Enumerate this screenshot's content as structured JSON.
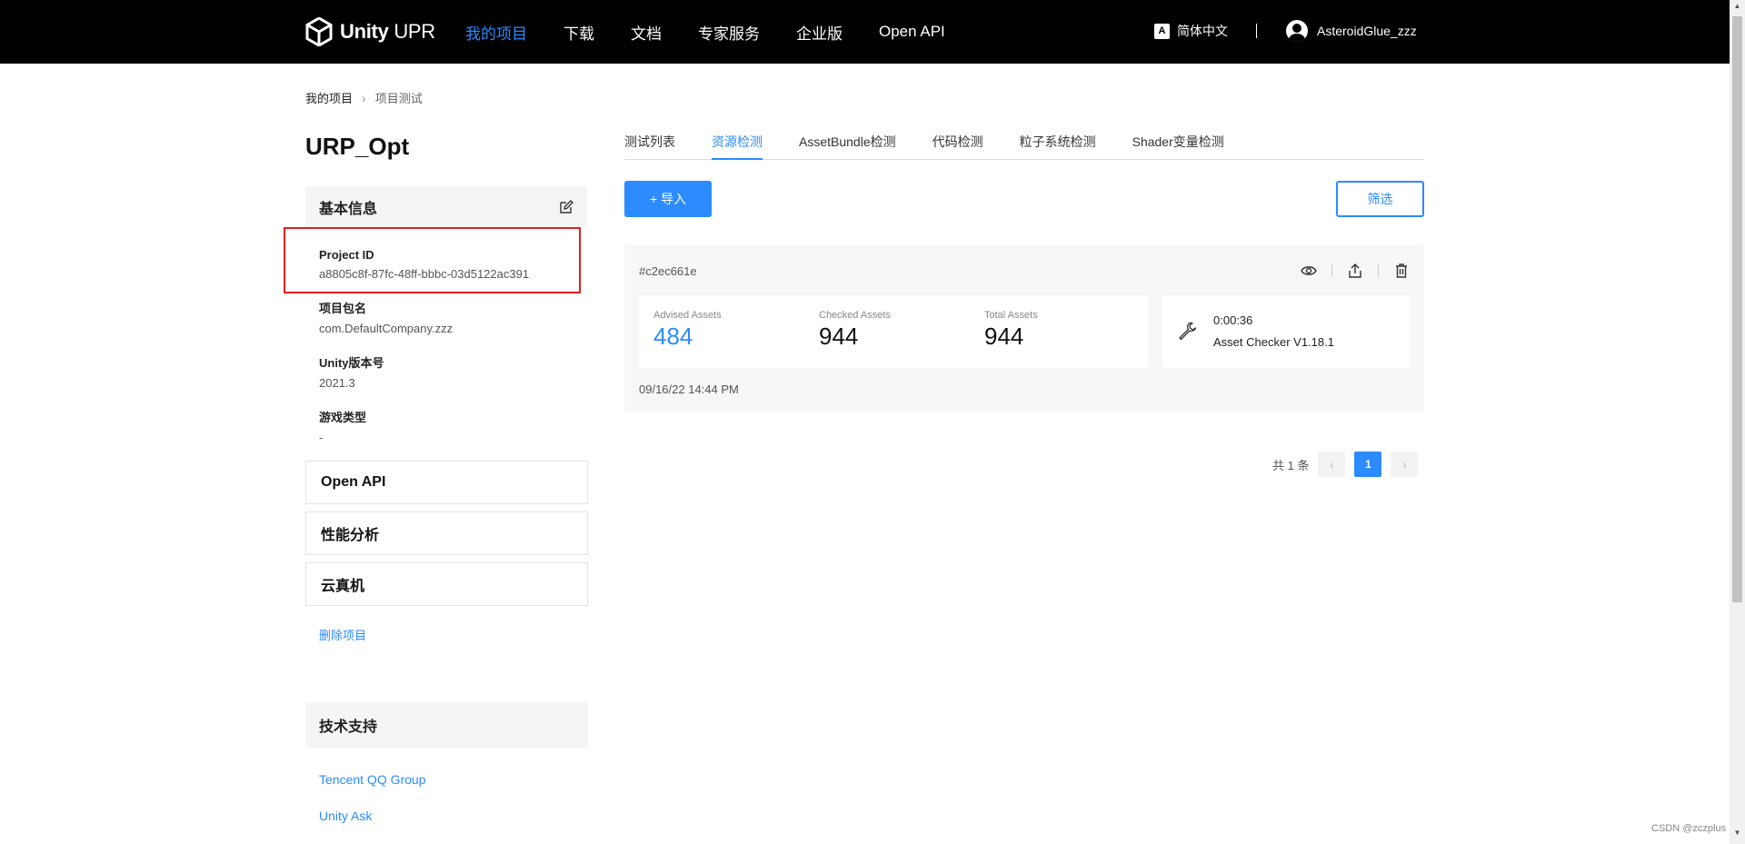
{
  "header": {
    "logo_text": "Unity",
    "logo_suffix": "UPR",
    "nav": [
      "我的项目",
      "下载",
      "文档",
      "专家服务",
      "企业版",
      "Open API"
    ],
    "language": "简体中文",
    "lang_icon": "A",
    "username": "AsteroidGlue_zzz"
  },
  "breadcrumb": {
    "root": "我的项目",
    "current": "项目测试"
  },
  "project": {
    "title": "URP_Opt"
  },
  "basic_info": {
    "title": "基本信息",
    "fields": [
      {
        "label": "Project ID",
        "value": "a8805c8f-87fc-48ff-bbbc-03d5122ac391"
      },
      {
        "label": "项目包名",
        "value": "com.DefaultCompany.zzz"
      },
      {
        "label": "Unity版本号",
        "value": "2021.3"
      },
      {
        "label": "游戏类型",
        "value": "-"
      }
    ]
  },
  "sections": [
    "Open API",
    "性能分析",
    "云真机"
  ],
  "delete_label": "删除项目",
  "support": {
    "title": "技术支持",
    "links": [
      "Tencent QQ Group",
      "Unity Ask"
    ]
  },
  "tabs": [
    "测试列表",
    "资源检测",
    "AssetBundle检测",
    "代码检测",
    "粒子系统检测",
    "Shader变量检测"
  ],
  "active_tab": "资源检测",
  "import_label": "+ 导入",
  "filter_label": "筛选",
  "report": {
    "id": "#c2ec661e",
    "stats": [
      {
        "label": "Advised Assets",
        "value": "484"
      },
      {
        "label": "Checked Assets",
        "value": "944"
      },
      {
        "label": "Total Assets",
        "value": "944"
      }
    ],
    "duration": "0:00:36",
    "tool": "Asset Checker V1.18.1",
    "date": "09/16/22 14:44 PM"
  },
  "pagination": {
    "total": "共 1 条",
    "current_page": "1",
    "prev": "‹",
    "next": "›"
  },
  "watermark": "CSDN @zczplus",
  "colors": {
    "accent": "#2b8bff",
    "highlight": "#e02020",
    "topbar": "#000000"
  }
}
